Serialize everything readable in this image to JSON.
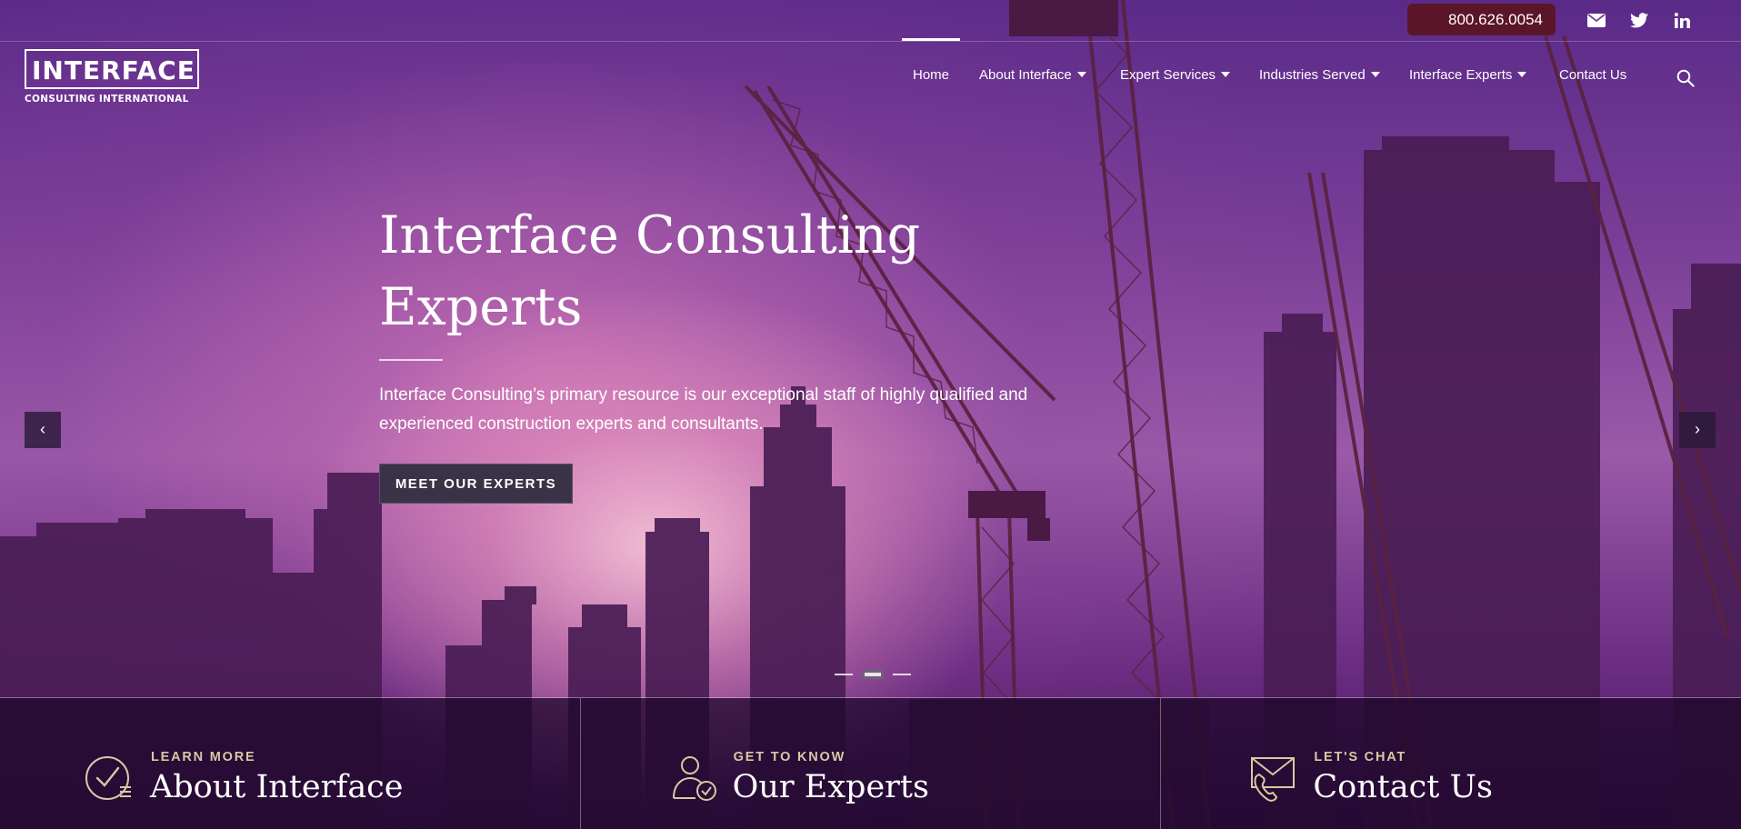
{
  "topbar": {
    "phone": "800.626.0054",
    "social_icons": [
      "envelope-icon",
      "twitter-icon",
      "linkedin-icon"
    ]
  },
  "logo": {
    "word": "INTERFACE",
    "subtitle": "CONSULTING INTERNATIONAL"
  },
  "nav": {
    "items": [
      {
        "label": "Home",
        "active": true,
        "dropdown": false
      },
      {
        "label": "About Interface",
        "dropdown": true
      },
      {
        "label": "Expert Services",
        "dropdown": true
      },
      {
        "label": "Industries Served",
        "dropdown": true
      },
      {
        "label": "Interface Experts",
        "dropdown": true
      },
      {
        "label": "Contact Us",
        "dropdown": false
      }
    ]
  },
  "hero": {
    "title_line1": "Interface Consulting",
    "title_line2": "Experts",
    "description_line1": "Interface Consulting’s primary resource is our exceptional staff of highly qualified and",
    "description_line2": "experienced construction experts and consultants.",
    "cta_label": "MEET OUR EXPERTS",
    "prev_label": "‹",
    "next_label": "›",
    "slides": 3,
    "active_slide": 2
  },
  "panels": [
    {
      "kicker": "LEARN MORE",
      "title": "About Interface",
      "icon": "checkmark-list-icon"
    },
    {
      "kicker": "GET TO KNOW",
      "title": "Our Experts",
      "icon": "person-check-icon"
    },
    {
      "kicker": "LET'S CHAT",
      "title": "Contact Us",
      "icon": "envelope-phone-icon"
    }
  ],
  "colors": {
    "phone_bg": "#5b1528",
    "cta_bg": "#3a3348",
    "kicker": "#d9c8a4",
    "panel_bg": "#1c0628"
  }
}
